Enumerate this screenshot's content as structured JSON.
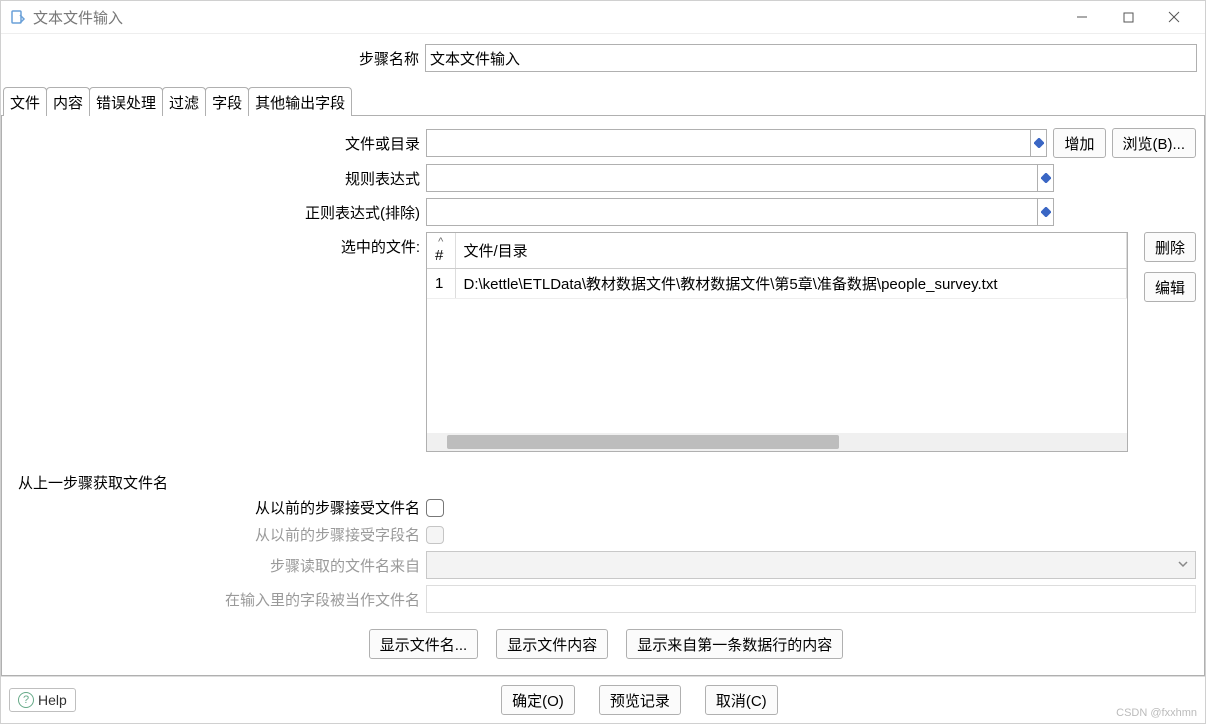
{
  "window": {
    "title": "文本文件输入"
  },
  "step": {
    "label": "步骤名称",
    "value": "文本文件输入"
  },
  "tabs": [
    "文件",
    "内容",
    "错误处理",
    "过滤",
    "字段",
    "其他输出字段"
  ],
  "fields": {
    "file_or_dir": {
      "label": "文件或目录",
      "value": ""
    },
    "regex": {
      "label": "规则表达式",
      "value": ""
    },
    "regex_excl": {
      "label": "正则表达式(排除)",
      "value": ""
    },
    "selected_files": {
      "label": "选中的文件:"
    }
  },
  "buttons": {
    "add": "增加",
    "browse": "浏览(B)...",
    "delete": "删除",
    "edit": "编辑",
    "show_names": "显示文件名...",
    "show_content": "显示文件内容",
    "show_first_row": "显示来自第一条数据行的内容",
    "ok": "确定(O)",
    "preview": "预览记录",
    "cancel": "取消(C)",
    "help": "Help"
  },
  "table": {
    "cols": {
      "idx": "#",
      "path": "文件/目录"
    },
    "rows": [
      {
        "idx": "1",
        "path": "D:\\kettle\\ETLData\\教材数据文件\\教材数据文件\\第5章\\准备数据\\people_survey.txt"
      }
    ]
  },
  "prev_step": {
    "group": "从上一步骤获取文件名",
    "accept_filename": "从以前的步骤接受文件名",
    "accept_fieldname": "从以前的步骤接受字段名",
    "step_source": "步骤读取的文件名来自",
    "field_as_filename": "在输入里的字段被当作文件名"
  },
  "watermark": "CSDN @fxxhmn"
}
